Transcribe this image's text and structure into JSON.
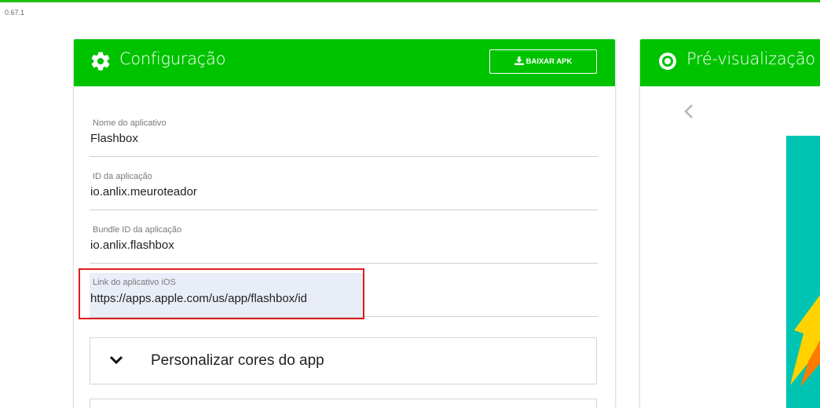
{
  "app": {
    "version": "0.67.1"
  },
  "config": {
    "title": "Configuração",
    "download_label": "BAIXAR APK",
    "fields": [
      {
        "label": "Nome do aplicativo",
        "value": "Flashbox"
      },
      {
        "label": "ID da aplicação",
        "value": "io.anlix.meuroteador"
      },
      {
        "label": "Bundle ID da aplicação",
        "value": "io.anlix.flashbox"
      },
      {
        "label": "Link do aplicativo iOS",
        "value": "https://apps.apple.com/us/app/flashbox/id"
      }
    ],
    "accordion": {
      "label": "Personalizar cores do app"
    }
  },
  "preview": {
    "title": "Pré-visualização d"
  },
  "colors": {
    "header_green": "#00c300",
    "highlight_red": "#e01b1b",
    "phone_teal": "#00c4b3"
  },
  "icons": [
    "gear-icon",
    "download-icon",
    "eye-icon",
    "chevron-down-icon",
    "chevron-left-icon"
  ]
}
